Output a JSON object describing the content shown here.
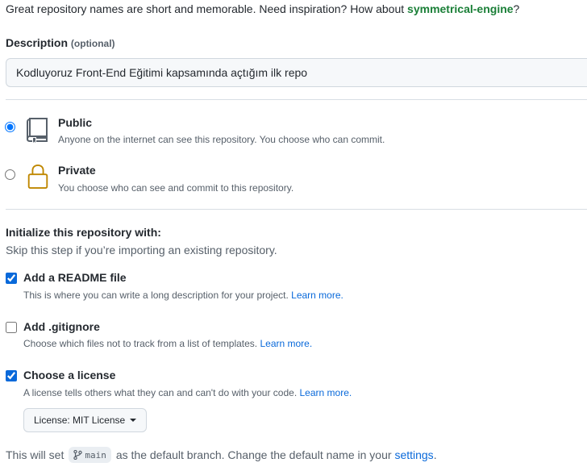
{
  "name_hint": {
    "text": "Great repository names are short and memorable. Need inspiration? How about ",
    "suggestion": "symmetrical-engine",
    "end": "?"
  },
  "description": {
    "label": "Description",
    "optional": "(optional)",
    "value": "Kodluyoruz Front-End Eğitimi kapsamında açtığım ilk repo"
  },
  "visibility": {
    "public": {
      "title": "Public",
      "desc": "Anyone on the internet can see this repository. You choose who can commit.",
      "selected": true,
      "icon": "repo-icon"
    },
    "private": {
      "title": "Private",
      "desc": "You choose who can see and commit to this repository.",
      "selected": false,
      "icon": "lock-icon"
    }
  },
  "initialize": {
    "title": "Initialize this repository with:",
    "subtitle": "Skip this step if you’re importing an existing repository.",
    "readme": {
      "title": "Add a README file",
      "desc": "This is where you can write a long description for your project. ",
      "link": "Learn more.",
      "checked": true
    },
    "gitignore": {
      "title": "Add .gitignore",
      "desc": "Choose which files not to track from a list of templates. ",
      "link": "Learn more.",
      "checked": false
    },
    "license": {
      "title": "Choose a license",
      "desc": "A license tells others what they can and can't do with your code. ",
      "link": "Learn more.",
      "checked": true,
      "button_label": "License: MIT License"
    }
  },
  "branch": {
    "prefix": "This will set",
    "name": "main",
    "middle": "as the default branch. Change the default name in your",
    "link": "settings",
    "end": "."
  },
  "colors": {
    "accent": "#0969da",
    "suggestion": "#1a7f37",
    "lock": "#bf8700"
  }
}
